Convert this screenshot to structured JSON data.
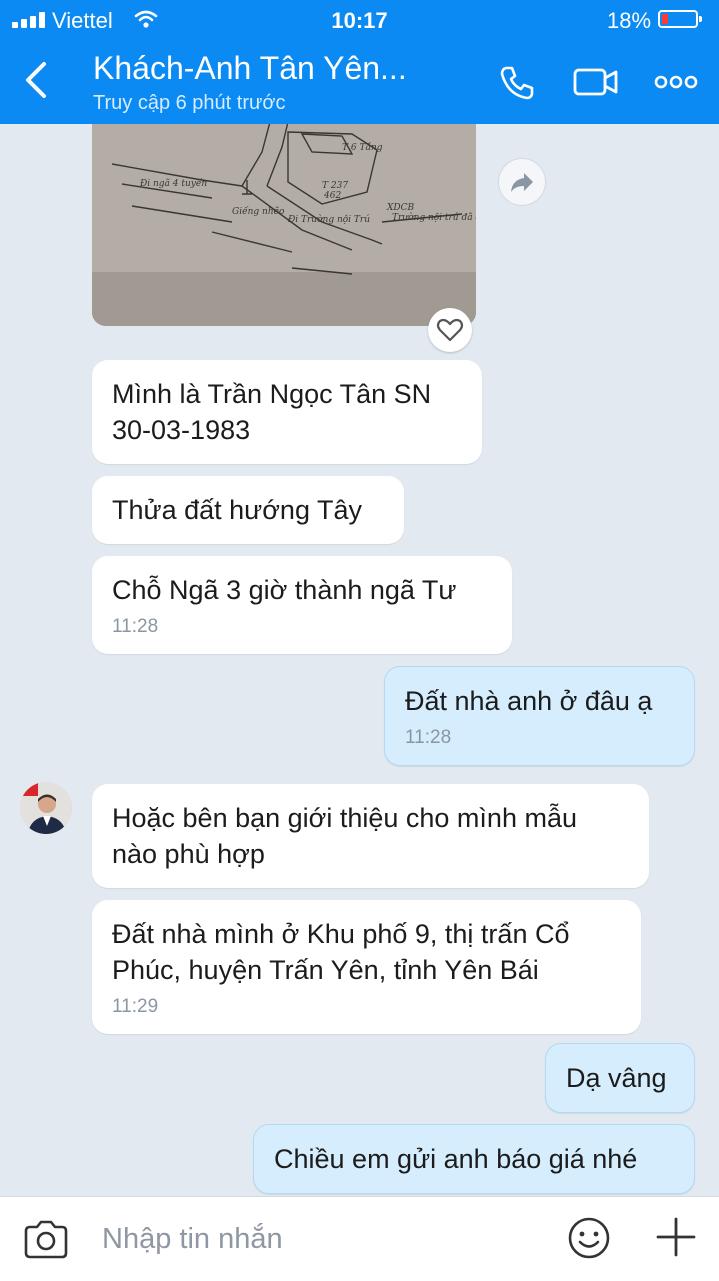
{
  "status_bar": {
    "carrier": "Viettel",
    "time": "10:17",
    "battery_percent": "18%",
    "battery_level": 0.18,
    "battery_color": "#ff3b30"
  },
  "header": {
    "title": "Khách-Anh Tân Yên...",
    "subtitle": "Truy cập 6 phút trước",
    "background_color": "#0a8af2",
    "icons": [
      "back-icon",
      "phone-icon",
      "video-call-icon",
      "more-icon"
    ]
  },
  "messages": [
    {
      "side": "in",
      "text": "Mình là Trần Ngọc Tân SN 30-03-1983"
    },
    {
      "side": "in",
      "text": "Thửa đất hướng Tây"
    },
    {
      "side": "in",
      "text": "Chỗ Ngã 3 giờ thành ngã Tư",
      "time": "11:28"
    },
    {
      "side": "out",
      "text": "Đất nhà anh ở đâu ạ",
      "time": "11:28"
    },
    {
      "side": "in",
      "text": "Hoặc bên bạn giới thiệu cho mình mẫu nào phù hợp"
    },
    {
      "side": "in",
      "text": "Đất nhà mình ở Khu phố 9, thị trấn Cổ Phúc, huyện Trấn Yên, tỉnh Yên Bái",
      "time": "11:29"
    },
    {
      "side": "out",
      "text": "Dạ vâng"
    },
    {
      "side": "out",
      "text": "Chiều em gửi anh báo giá nhé"
    }
  ],
  "input_bar": {
    "placeholder": "Nhập tin nhắn",
    "icons": [
      "camera-icon",
      "emoji-icon",
      "plus-icon"
    ]
  }
}
